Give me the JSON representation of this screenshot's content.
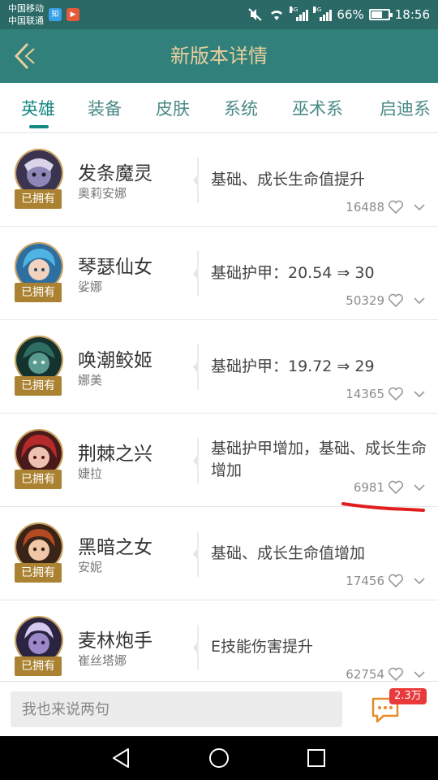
{
  "status_bar": {
    "carrier_1": "中国移动",
    "carrier_2": "中国联通",
    "app_badge_1": "知",
    "app_badge_2": "▶",
    "network_1": "4G",
    "network_2": "3G",
    "battery": "66%",
    "battery_level": 0.66,
    "time": "18:56"
  },
  "header": {
    "title": "新版本详情"
  },
  "tabs": [
    {
      "label": "英雄",
      "active": true
    },
    {
      "label": "装备",
      "active": false
    },
    {
      "label": "皮肤",
      "active": false
    },
    {
      "label": "系统",
      "active": false
    },
    {
      "label": "巫术系",
      "active": false
    },
    {
      "label": "启迪系",
      "active": false
    }
  ],
  "heroes": [
    {
      "name": "发条魔灵",
      "subname": "奥莉安娜",
      "badge": "已拥有",
      "description": "基础、成长生命值提升",
      "likes": "16488"
    },
    {
      "name": "琴瑟仙女",
      "subname": "娑娜",
      "badge": "已拥有",
      "description": "基础护甲：20.54 ⇒ 30",
      "likes": "50329"
    },
    {
      "name": "唤潮鲛姬",
      "subname": "娜美",
      "badge": "已拥有",
      "description": "基础护甲：19.72 ⇒ 29",
      "likes": "14365"
    },
    {
      "name": "荆棘之兴",
      "subname": "婕拉",
      "badge": "已拥有",
      "description": "基础护甲增加，基础、成长生命增加",
      "likes": "6981"
    },
    {
      "name": "黑暗之女",
      "subname": "安妮",
      "badge": "已拥有",
      "description": "基础、成长生命值增加",
      "likes": "17456"
    },
    {
      "name": "麦林炮手",
      "subname": "崔丝塔娜",
      "badge": "已拥有",
      "description": "E技能伤害提升",
      "likes": "62754"
    }
  ],
  "comment_bar": {
    "placeholder": "我也来说两句",
    "comment_count": "2.3万"
  },
  "colors": {
    "header_bg": "#31807b",
    "status_bg": "#2a6966",
    "title_gold": "#e7cf9e",
    "accent_teal": "#168882",
    "owned_badge": "#ab8231",
    "annotation_red": "#e01e1e"
  },
  "icons": {
    "back": "back-chevron-icon",
    "like": "heart-icon",
    "expand": "chevron-down-icon",
    "comment": "comment-bubble-icon",
    "nav_back": "triangle-back-icon",
    "nav_home": "circle-home-icon",
    "nav_recent": "square-recent-icon"
  }
}
